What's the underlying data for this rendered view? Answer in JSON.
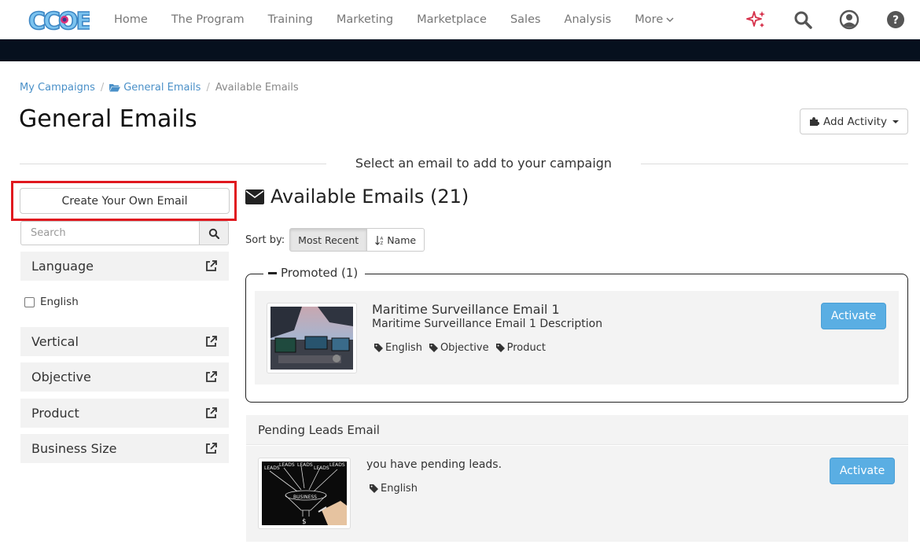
{
  "brand": {
    "logo_text": "CCOE",
    "accent": "#4a90c8"
  },
  "nav": {
    "items": [
      "Home",
      "The Program",
      "Training",
      "Marketing",
      "Marketplace",
      "Sales",
      "Analysis"
    ],
    "more_label": "More",
    "icons": [
      "sparkle-icon",
      "search-icon",
      "user-icon",
      "help-icon"
    ]
  },
  "breadcrumb": {
    "items": [
      "My Campaigns",
      "General Emails",
      "Available Emails"
    ]
  },
  "page": {
    "title": "General Emails",
    "add_activity_label": "Add Activity",
    "subheading": "Select an email to add to your campaign"
  },
  "sidebar": {
    "create_button": "Create Your Own Email",
    "search_placeholder": "Search",
    "filters": [
      "Language",
      "Vertical",
      "Objective",
      "Product",
      "Business Size"
    ],
    "language_options": [
      {
        "label": "English",
        "checked": false
      }
    ]
  },
  "main": {
    "title": "Available Emails (21)",
    "sort": {
      "label": "Sort by:",
      "options": [
        "Most Recent",
        "Name"
      ],
      "active": "Most Recent"
    },
    "promoted": {
      "legend": "Promoted (1)",
      "email": {
        "name": "Maritime Surveillance Email 1",
        "description": "Maritime Surveillance Email 1 Description",
        "tags": [
          "English",
          "Objective",
          "Product"
        ],
        "action": "Activate"
      }
    },
    "pending": {
      "header": "Pending Leads Email",
      "description": "you have pending leads.",
      "tags": [
        "English"
      ],
      "action": "Activate"
    }
  }
}
